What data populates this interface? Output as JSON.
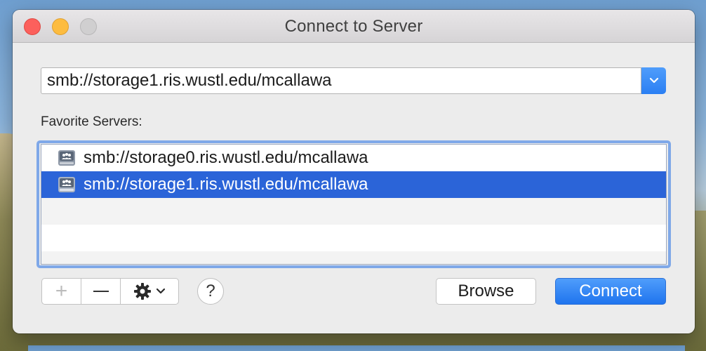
{
  "window": {
    "title": "Connect to Server"
  },
  "address": {
    "value": "smb://storage1.ris.wustl.edu/mcallawa"
  },
  "favorites": {
    "label": "Favorite Servers:",
    "items": [
      {
        "label": "smb://storage0.ris.wustl.edu/mcallawa",
        "icon": "server-icon",
        "selected": false
      },
      {
        "label": "smb://storage1.ris.wustl.edu/mcallawa",
        "icon": "server-icon",
        "selected": true
      }
    ]
  },
  "toolbar": {
    "add_label": "+",
    "help_label": "?"
  },
  "buttons": {
    "browse_label": "Browse",
    "connect_label": "Connect"
  },
  "colors": {
    "accent": "#2b7ff3",
    "selection": "#2b64d8"
  }
}
